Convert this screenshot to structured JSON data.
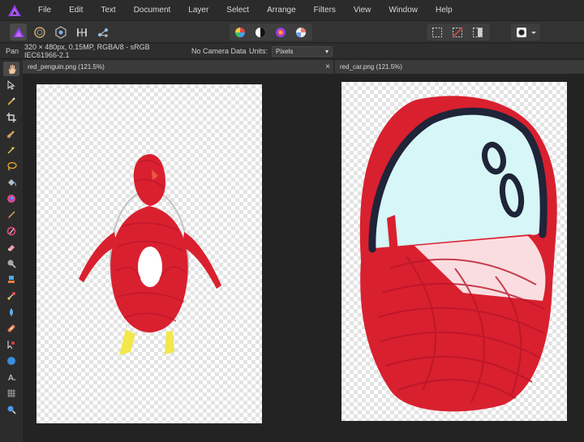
{
  "menubar": {
    "items": [
      "File",
      "Edit",
      "Text",
      "Document",
      "Layer",
      "Select",
      "Arrange",
      "Filters",
      "View",
      "Window",
      "Help"
    ]
  },
  "toolbar": {
    "personas": [
      "photo-persona-icon",
      "liquify-persona-icon",
      "develop-persona-icon",
      "tone-mapping-persona-icon",
      "export-persona-icon"
    ],
    "adjustments": [
      "color-wheel-icon",
      "contrast-icon",
      "hsl-icon",
      "white-balance-icon"
    ],
    "selection_modes": [
      "marquee-select-icon",
      "deselect-icon",
      "invert-selection-icon"
    ],
    "mask_label": "quick-mask-icon"
  },
  "context": {
    "tool_name": "Pan",
    "doc_info": "320 × 480px, 0.15MP, RGBA/8 - sRGB IEC61966-2.1",
    "camera": "No Camera Data",
    "units_label": "Units:",
    "units_value": "Pixels"
  },
  "tabs": [
    {
      "title": "red_penguin.png (121.5%)",
      "close": "×"
    },
    {
      "title": "red_car.png (121.5%)"
    }
  ],
  "tools": [
    "hand-tool-icon",
    "move-tool-icon",
    "color-picker-icon",
    "crop-tool-icon",
    "selection-brush-icon",
    "flood-select-icon",
    "freehand-selection-icon",
    "flood-fill-icon",
    "gradient-tool-icon",
    "paint-brush-icon",
    "color-replacement-icon",
    "erase-brush-icon",
    "dodge-brush-icon",
    "clone-brush-icon",
    "smudge-brush-icon",
    "blur-brush-icon",
    "inpainting-brush-icon",
    "red-eye-tool-icon",
    "pen-tool-icon",
    "shape-tool-icon",
    "text-tool-icon",
    "mesh-warp-icon",
    "zoom-tool-icon"
  ],
  "colors": {
    "accent": "#7c3aed",
    "drawing_red": "#d9202f",
    "car_window": "#d7f6f7",
    "outline_navy": "#1f2438",
    "feet_yellow": "#f2e84a"
  }
}
